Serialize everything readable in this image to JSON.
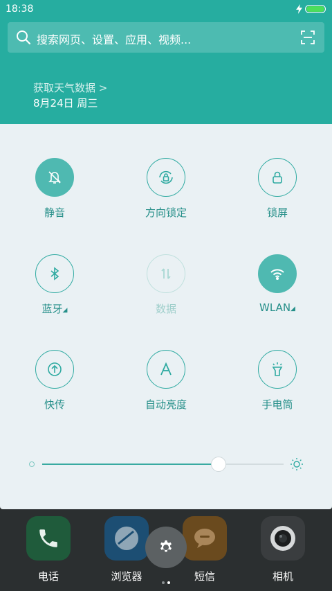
{
  "status_bar": {
    "time": "18:38"
  },
  "search": {
    "placeholder": "搜索网页、设置、应用、视频..."
  },
  "weather": {
    "link": "获取天气数据 >",
    "date": "8月24日 周三"
  },
  "toggles": [
    {
      "label": "静音",
      "icon": "bell-off-icon",
      "state": "on"
    },
    {
      "label": "方向锁定",
      "icon": "rotation-lock-icon",
      "state": "outline"
    },
    {
      "label": "锁屏",
      "icon": "lock-icon",
      "state": "outline"
    },
    {
      "label": "蓝牙",
      "icon": "bluetooth-icon",
      "state": "outline",
      "expandable": true
    },
    {
      "label": "数据",
      "icon": "mobile-data-icon",
      "state": "disabled"
    },
    {
      "label": "WLAN",
      "icon": "wifi-icon",
      "state": "on",
      "expandable": true
    },
    {
      "label": "快传",
      "icon": "transfer-icon",
      "state": "outline"
    },
    {
      "label": "自动亮度",
      "icon": "auto-brightness-icon",
      "state": "outline"
    },
    {
      "label": "手电筒",
      "icon": "flashlight-icon",
      "state": "outline"
    }
  ],
  "brightness": {
    "level": 0.73
  },
  "dock": [
    {
      "label": "电话",
      "icon": "phone-icon",
      "color": "#1f5b3b"
    },
    {
      "label": "浏览器",
      "icon": "browser-icon",
      "color": "#1c4e73"
    },
    {
      "label": "短信",
      "icon": "message-icon",
      "color": "#6a4a1e"
    },
    {
      "label": "相机",
      "icon": "camera-icon",
      "color": "#3a3d3f"
    }
  ],
  "colors": {
    "accent": "#26ada0",
    "panel": "#eaf1f4"
  }
}
